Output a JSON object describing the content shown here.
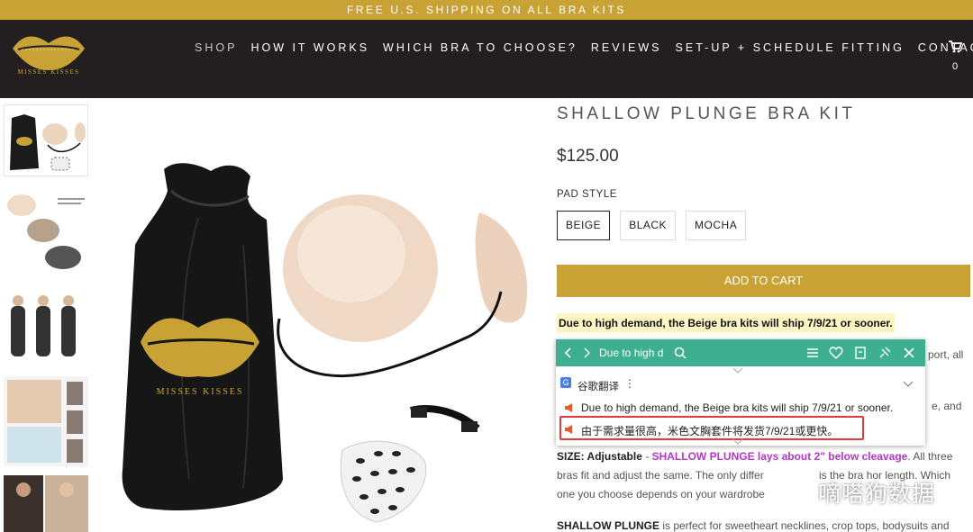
{
  "promo": {
    "text": "FREE U.S. SHIPPING ON ALL BRA KITS"
  },
  "brand": {
    "logo_text": "MISSES KISSES"
  },
  "nav": {
    "items": [
      {
        "label": "SHOP"
      },
      {
        "label": "HOW IT WORKS"
      },
      {
        "label": "WHICH BRA TO CHOOSE?"
      },
      {
        "label": "REVIEWS"
      },
      {
        "label": "SET-UP + SCHEDULE FITTING"
      },
      {
        "label": "CONTACT"
      }
    ],
    "cart_count": "0",
    "cart_icon": "shopping-cart-icon"
  },
  "product": {
    "title": "SHALLOW PLUNGE BRA KIT",
    "price": "$125.00",
    "pad_style_label": "PAD STYLE",
    "options": [
      "BEIGE",
      "BLACK",
      "MOCHA"
    ],
    "selected_option": "BEIGE",
    "add_to_cart": "ADD TO CART",
    "notice": "Due to high demand, the Beige bra kits will ship 7/9/21 or sooner.",
    "desc": {
      "right_fragment_1": "port, all",
      "right_fragment_2": "e, and",
      "size_label": "SIZE: Adjustable",
      "size_dash": " - ",
      "size_link": "SHALLOW PLUNGE lays about 2\" below cleavage",
      "size_tail": ". All three",
      "line2_start": "bras fit and adjust the same. The only differ",
      "line2_end": "is the bra hor length. Which",
      "line3_start": "one you choose depends on your wardrobe",
      "shallow_label": "SHALLOW PLUNGE",
      "shallow_rest": " is perfect for sweetheart necklines, crop tops, bodysuits and"
    }
  },
  "popup": {
    "query": "Due to high d",
    "source": "谷歌翻译",
    "source_icon_letter": "G",
    "original": "Due to high demand, the Beige bra kits will ship 7/9/21 or sooner.",
    "translation": "由于需求量很高，米色文胸套件将发货7/9/21或更快。",
    "colors": {
      "bar": "#3eaf8f",
      "highlight": "#e23b3b"
    }
  },
  "watermark": {
    "text": "嘀嗒狗数据"
  },
  "colors": {
    "gold": "#c9a236",
    "header_bg": "#231f20",
    "notice_bg": "#fdf6c4",
    "link": "#b437c8"
  }
}
